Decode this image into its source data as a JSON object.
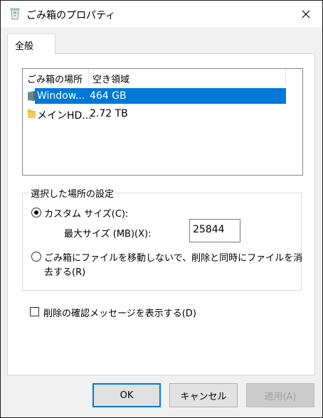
{
  "window": {
    "title": "ごみ箱のプロパティ",
    "title_icon": "recycle-bin-icon",
    "close_icon": "close-icon"
  },
  "tabs": [
    {
      "label": "全般",
      "selected": true
    }
  ],
  "list": {
    "columns": [
      "ごみ箱の場所",
      "空き領域"
    ],
    "rows": [
      {
        "name": "Window...",
        "free": "464 GB",
        "icon": "drive-icon",
        "selected": true
      },
      {
        "name": "メインHD...",
        "free": "2.72 TB",
        "icon": "folder-icon",
        "selected": false
      }
    ]
  },
  "settings": {
    "legend": "選択した場所の設定",
    "custom_size_label": "カスタム サイズ(C):",
    "max_size_label": "最大サイズ (MB)(X):",
    "max_size_value": "25844",
    "no_move_label_line1": "ごみ箱にファイルを移動しないで、削除と同時にファイルを消",
    "no_move_label_line2": "去する(R)",
    "custom_size_selected": true
  },
  "confirm_delete": {
    "label": "削除の確認メッセージを表示する(D)",
    "checked": false
  },
  "buttons": {
    "ok": "OK",
    "cancel": "キャンセル",
    "apply": "適用(A)",
    "apply_disabled": true
  },
  "colors": {
    "selection": "#0078d7",
    "default_button_border": "#0078d7",
    "folder": "#e8b93a",
    "drive": "#6d8a94"
  }
}
